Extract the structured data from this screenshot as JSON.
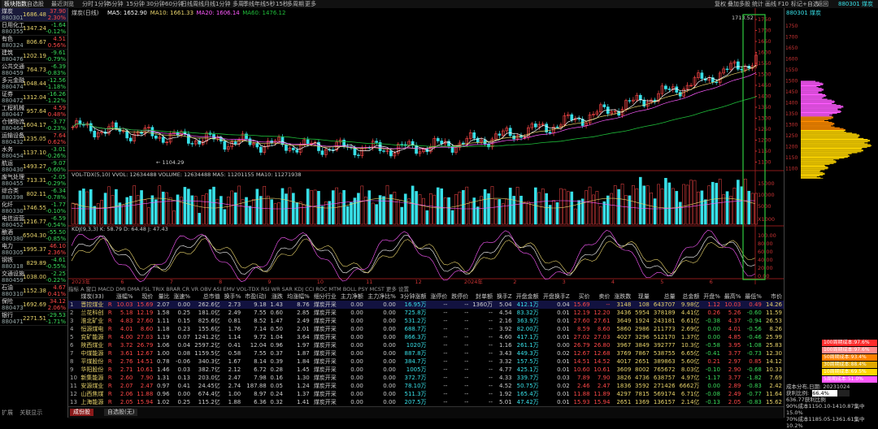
{
  "top_tabs": [
    "板块指数",
    "自选股",
    "最近浏览",
    "分时",
    "1分钟",
    "5分钟",
    "15分钟",
    "30分钟",
    "60分钟",
    "日线",
    "周线",
    "月线",
    "1分钟",
    "多周",
    "季线",
    "年线",
    "5秒",
    "15秒",
    "多周期",
    "更多"
  ],
  "top_tools": [
    "复权",
    "叠加",
    "多股",
    "统计",
    "画线",
    "F10",
    "标记",
    "+自选",
    "返回"
  ],
  "top_right_code": "880301 煤炭",
  "sectors": [
    {
      "name": "煤炭",
      "code": "880301",
      "price": "1686.48",
      "change": "37.90",
      "pct": "2.30%",
      "dir": "up"
    },
    {
      "name": "日用化工",
      "code": "880355",
      "price": "1347.24",
      "change": "-1.64",
      "pct": "-0.12%",
      "dir": "dn"
    },
    {
      "name": "有色",
      "code": "880324",
      "price": "806.67",
      "change": "4.51",
      "pct": "0.56%",
      "dir": "up"
    },
    {
      "name": "建筑",
      "code": "880476",
      "price": "1202.19",
      "change": "-9.61",
      "pct": "-0.79%",
      "dir": "dn"
    },
    {
      "name": "公共交通",
      "code": "880459",
      "price": "764.73",
      "change": "-6.39",
      "pct": "-0.83%",
      "dir": "dn"
    },
    {
      "name": "多元金融",
      "code": "880474",
      "price": "1048.44",
      "change": "-12.56",
      "pct": "-1.18%",
      "dir": "dn"
    },
    {
      "name": "证券",
      "code": "880472",
      "price": "1312.04",
      "change": "-16.26",
      "pct": "-1.22%",
      "dir": "dn"
    },
    {
      "name": "工程机械",
      "code": "880447",
      "price": "957.64",
      "change": "4.59",
      "pct": "0.48%",
      "dir": "up"
    },
    {
      "name": "仓储物流",
      "code": "880464",
      "price": "1604.17",
      "change": "-3.77",
      "pct": "-0.23%",
      "dir": "dn"
    },
    {
      "name": "运输设备",
      "code": "880432",
      "price": "1235.05",
      "change": "7.64",
      "pct": "0.62%",
      "dir": "up"
    },
    {
      "name": "水务",
      "code": "880454",
      "price": "1137.10",
      "change": "-3.01",
      "pct": "-0.26%",
      "dir": "dn"
    },
    {
      "name": "航运",
      "code": "880430",
      "price": "1493.27",
      "change": "-9.07",
      "pct": "-0.60%",
      "dir": "dn"
    },
    {
      "name": "废气处理",
      "code": "880455",
      "price": "713.31",
      "change": "-2.05",
      "pct": "-0.29%",
      "dir": "dn"
    },
    {
      "name": "综合类",
      "code": "880398",
      "price": "802.11",
      "change": "-6.34",
      "pct": "-0.78%",
      "dir": "dn"
    },
    {
      "name": "化纤",
      "code": "880330",
      "price": "1746.55",
      "change": "-1.77",
      "pct": "-0.10%",
      "dir": "dn"
    },
    {
      "name": "电信运营",
      "code": "880452",
      "price": "1216.77",
      "change": "-6.59",
      "pct": "-0.54%",
      "dir": "dn"
    },
    {
      "name": "酿酒",
      "code": "880380",
      "price": "6504.30",
      "change": "-55.50",
      "pct": "-0.85%",
      "dir": "dn"
    },
    {
      "name": "电力",
      "code": "880305",
      "price": "1995.37",
      "change": "46.10",
      "pct": "2.36%",
      "dir": "up"
    },
    {
      "name": "钢铁",
      "code": "880318",
      "price": "829.89",
      "change": "-4.61",
      "pct": "-0.55%",
      "dir": "dn"
    },
    {
      "name": "交通设施",
      "code": "880459",
      "price": "1038.00",
      "change": "-2.25",
      "pct": "-0.22%",
      "dir": "dn"
    },
    {
      "name": "石油",
      "code": "880310",
      "price": "1152.38",
      "change": "4.67",
      "pct": "0.41%",
      "dir": "up"
    },
    {
      "name": "保险",
      "code": "880473",
      "price": "1692.69",
      "change": "34.12",
      "pct": "2.06%",
      "dir": "up"
    },
    {
      "name": "银行",
      "code": "880471",
      "price": "2271.51",
      "change": "-29.53",
      "pct": "-1.71%",
      "dir": "dn"
    }
  ],
  "main_chart": {
    "legend_name": "煤炭(日线)",
    "ma_labels": [
      "MA5: 1652.90",
      "MA10: 1661.33",
      "MA20: 1606.14",
      "MA60: 1476.12"
    ],
    "price_high_label": "1713.52",
    "price_low_label": "1104.29",
    "y_ticks": [
      "1750",
      "1700",
      "1650",
      "1600",
      "1550",
      "1500",
      "1450",
      "1400",
      "1350",
      "1300",
      "1250",
      "1200",
      "1150",
      "1100"
    ]
  },
  "vol_chart": {
    "legend": "VOL-TDX(5,10) VVOL: 12634488  VOLUME: 12634488  MA5: 11201155  MA10: 11271938",
    "y_ticks": [
      "15000",
      "10000",
      "5000",
      "X1000"
    ]
  },
  "kdj_chart": {
    "legend": "KDJ(9,3,3) K: 58.79 D: 64.48 J: 47.43",
    "y_ticks": [
      "100.00",
      "80.00",
      "60.00",
      "40.00",
      "20.00",
      "0.00"
    ]
  },
  "xaxis_labels": [
    "2023年",
    "6",
    "7",
    "8",
    "9",
    "10",
    "11",
    "12",
    "2024年",
    "2",
    "3",
    "4",
    "5",
    "6"
  ],
  "indicator_strip": "指标 A 窗口 MACD DMI DMA FSL TRIX BRAR CR VR OBV ASI EMV VOL-TDX RSI WR SAR KDJ CCI ROC MTM BOLL PSY MCST 更多 设置",
  "table": {
    "headers": [
      "",
      "煤炭(33)",
      "",
      "涨幅%",
      "现价",
      "量比",
      "涨速%",
      "总市值",
      "换手%",
      "市盈(动)",
      "涨跌",
      "均涨幅%",
      "细分行业",
      "主力净额",
      "主力净比%",
      "3分钟涨额",
      "涨停价",
      "跌停价",
      "封单额",
      "换手Z",
      "开盘金额",
      "开盘换手Z",
      "买价",
      "卖价",
      "涨跌数",
      "现量",
      "总量",
      "总金额",
      "开盘%",
      "最高%",
      "最低%",
      "市价"
    ],
    "rows": [
      [
        "1",
        "晋控煤业",
        "R",
        "10.03",
        "15.69",
        "2.07",
        "0.00",
        "262.6亿",
        "2.73",
        "9.18",
        "1.43",
        "8.76",
        "煤炭开采",
        "0.00",
        "0.00",
        "16.95万",
        "--",
        "--",
        "1360万",
        "5.04",
        "412.1万",
        "0.04",
        "15.69",
        "--",
        "3148",
        "108",
        "643707",
        "9.98亿",
        "1.12",
        "10.03",
        "0.49",
        "14.26"
      ],
      [
        "2",
        "兰花科创",
        "R",
        "5.18",
        "12.19",
        "1.58",
        "0.25",
        "181.0亿",
        "2.49",
        "7.55",
        "0.60",
        "2.85",
        "煤炭开采",
        "0.00",
        "0.00",
        "725.8万",
        "--",
        "--",
        "--",
        "4.54",
        "83.32万",
        "0.01",
        "12.19",
        "12.20",
        "3436",
        "5954",
        "378189",
        "4.41亿",
        "0.26",
        "5.26",
        "-0.60",
        "11.59"
      ],
      [
        "3",
        "淮北矿业",
        "R",
        "4.83",
        "27.60",
        "1.11",
        "0.15",
        "825.6亿",
        "0.81",
        "8.52",
        "1.47",
        "2.49",
        "煤炭开采",
        "0.00",
        "0.00",
        "531.2万",
        "--",
        "--",
        "--",
        "2.16",
        "363.9万",
        "0.01",
        "27.60",
        "27.61",
        "3649",
        "1924",
        "243181",
        "6.61亿",
        "-0.38",
        "4.37",
        "-0.94",
        "26.53"
      ],
      [
        "4",
        "恒源煤电",
        "R",
        "4.01",
        "8.60",
        "1.18",
        "0.23",
        "155.6亿",
        "1.76",
        "7.14",
        "0.50",
        "2.01",
        "煤炭开采",
        "0.00",
        "0.00",
        "688.7万",
        "--",
        "--",
        "--",
        "3.92",
        "82.00万",
        "0.01",
        "8.59",
        "8.60",
        "5860",
        "2986",
        "211773",
        "2.69亿",
        "0.00",
        "4.01",
        "-0.56",
        "8.26"
      ],
      [
        "5",
        "兖矿能源",
        "R",
        "4.00",
        "27.03",
        "1.19",
        "0.07",
        "1241.2亿",
        "1.14",
        "9.72",
        "1.04",
        "3.64",
        "煤炭开采",
        "0.00",
        "0.00",
        "866.3万",
        "--",
        "--",
        "--",
        "4.60",
        "417.1万",
        "0.01",
        "27.02",
        "27.03",
        "4027",
        "3296",
        "512170",
        "1.37亿",
        "0.00",
        "4.85",
        "-0.46",
        "25.99"
      ],
      [
        "6",
        "陕西煤业",
        "R",
        "3.72",
        "26.79",
        "1.06",
        "0.04",
        "2597.2亿",
        "0.41",
        "12.04",
        "0.96",
        "1.97",
        "煤炭开采",
        "0.00",
        "0.00",
        "1020万",
        "--",
        "--",
        "--",
        "1.16",
        "261.1万",
        "0.00",
        "26.79",
        "26.80",
        "3967",
        "3849",
        "392777",
        "10.3亿",
        "-0.58",
        "3.95",
        "-1.08",
        "25.83"
      ],
      [
        "7",
        "中煤能源",
        "R",
        "3.61",
        "12.67",
        "1.00",
        "0.08",
        "1159.5亿",
        "0.58",
        "7.55",
        "0.37",
        "1.87",
        "煤炭开采",
        "0.00",
        "0.00",
        "887.8万",
        "--",
        "--",
        "--",
        "3.43",
        "449.3万",
        "0.02",
        "12.67",
        "12.68",
        "3769",
        "7867",
        "538755",
        "6.65亿",
        "-0.41",
        "3.77",
        "-0.73",
        "12.30"
      ],
      [
        "8",
        "平煤股份",
        "R",
        "2.76",
        "14.51",
        "0.78",
        "-0.06",
        "340.3亿",
        "1.67",
        "8.14",
        "0.39",
        "1.84",
        "煤炭开采",
        "0.00",
        "0.00",
        "384.7万",
        "--",
        "--",
        "--",
        "3.32",
        "157.5万",
        "0.01",
        "14.51",
        "14.52",
        "4017",
        "2651",
        "389863",
        "5.60亿",
        "0.21",
        "2.97",
        "0.85",
        "14.12"
      ],
      [
        "9",
        "华阳股份",
        "R",
        "2.71",
        "10.61",
        "1.46",
        "0.03",
        "382.7亿",
        "2.12",
        "6.72",
        "0.28",
        "1.45",
        "煤炭开采",
        "0.00",
        "0.00",
        "1005万",
        "--",
        "--",
        "--",
        "4.77",
        "425.1万",
        "0.01",
        "10.60",
        "10.61",
        "3609",
        "8002",
        "765672",
        "8.03亿",
        "-0.10",
        "2.90",
        "-0.68",
        "10.33"
      ],
      [
        "10",
        "新集能源",
        "R",
        "2.60",
        "7.90",
        "1.31",
        "0.13",
        "203.0亿",
        "2.47",
        "7.98",
        "0.16",
        "1.30",
        "煤炭开采",
        "0.00",
        "0.00",
        "372.7万",
        "--",
        "--",
        "--",
        "4.33",
        "339.7万",
        "0.03",
        "7.89",
        "7.90",
        "3826",
        "4736",
        "638757",
        "4.97亿",
        "-1.17",
        "3.77",
        "-1.82",
        "7.69"
      ],
      [
        "11",
        "安源煤业",
        "R",
        "2.07",
        "2.47",
        "0.97",
        "0.41",
        "24.45亿",
        "2.74",
        "187.88",
        "0.05",
        "1.24",
        "煤炭开采",
        "0.00",
        "0.00",
        "78.10万",
        "--",
        "--",
        "--",
        "4.52",
        "50.75万",
        "0.02",
        "2.46",
        "2.47",
        "1836",
        "3592",
        "271426",
        "6662万",
        "0.00",
        "2.89",
        "-0.83",
        "2.42"
      ],
      [
        "12",
        "山西焦煤",
        "R",
        "2.06",
        "11.88",
        "0.96",
        "0.00",
        "674.4亿",
        "1.00",
        "8.97",
        "0.24",
        "1.37",
        "煤炭开采",
        "0.00",
        "0.00",
        "511.3万",
        "--",
        "--",
        "--",
        "1.92",
        "165.4万",
        "0.01",
        "11.88",
        "11.89",
        "4297",
        "7815",
        "569174",
        "6.71亿",
        "-0.08",
        "2.49",
        "-0.77",
        "11.64"
      ],
      [
        "13",
        "上海能源",
        "R",
        "2.05",
        "15.94",
        "1.02",
        "0.25",
        "115.2亿",
        "1.88",
        "6.36",
        "0.32",
        "1.41",
        "煤炭开采",
        "0.00",
        "0.00",
        "207.5万",
        "--",
        "--",
        "--",
        "5.01",
        "47.42万",
        "0.01",
        "15.93",
        "15.94",
        "2651",
        "1369",
        "136157",
        "2.14亿",
        "-0.13",
        "2.05",
        "-0.83",
        "15.62"
      ]
    ]
  },
  "bottom_tabs": [
    "成份股",
    "自选股(无)"
  ],
  "bottom_status": [
    "扩展",
    "关联显示"
  ],
  "right_panel": {
    "title": "880301 煤炭",
    "legend": [
      {
        "label": "100周期成本:97.6%",
        "color": "#ff2c2c"
      },
      {
        "label": "100周期成本:97.6%",
        "color": "#ff8c8c"
      },
      {
        "label": "50周期成本:93.4%",
        "color": "#ff7f00"
      },
      {
        "label": "30周期成本:88.4%",
        "color": "#e0a800"
      },
      {
        "label": "10周期成本:69.5%",
        "color": "#ffd700"
      },
      {
        "label": "5周期成本:51.0%",
        "color": "#ff5aff"
      }
    ],
    "stats": [
      "成本分布,日期: 20231024",
      "获利比例:",
      "636.77获利比例",
      "90%成本1150.10-1410.87集中15.0%",
      "70%成本1185.05-1361.61集中10.2%"
    ],
    "profit_pct": "66.4%",
    "y_ticks": [
      "1750",
      "1700",
      "1650",
      "1600",
      "1550",
      "1500",
      "1450",
      "1400",
      "1350",
      "1300",
      "1250",
      "1200",
      "1150",
      "1100"
    ]
  },
  "colors": {
    "up": "#ff4848",
    "down": "#3adc5b",
    "ma5": "#ffffff",
    "ma10": "#e8d36b",
    "ma20": "#ff5aff",
    "ma60": "#1fbf3a",
    "vol_bar": "#38e0e8",
    "highlight_box": "#2ecc40"
  }
}
